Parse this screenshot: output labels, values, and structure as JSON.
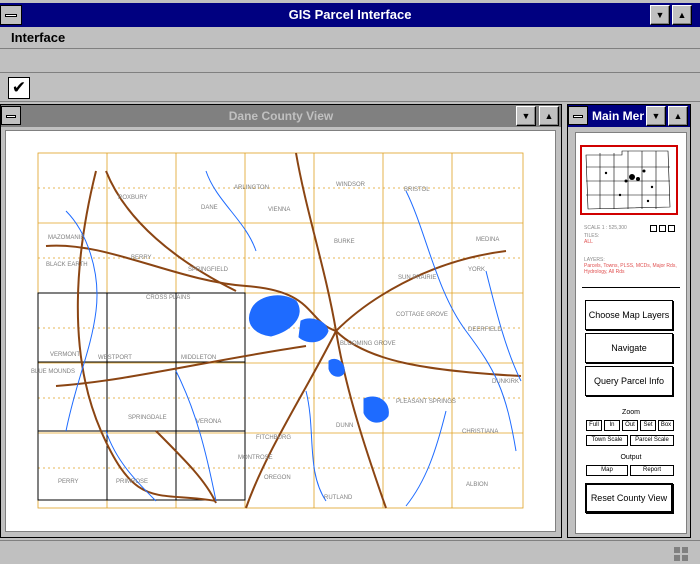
{
  "app": {
    "title": "GIS Parcel Interface",
    "minimize_glyph": "▼",
    "maximize_glyph": "▲"
  },
  "menubar": {
    "items": [
      "Interface"
    ]
  },
  "toolbar": {
    "check_glyph": "✔"
  },
  "map_window": {
    "title": "Dane County View"
  },
  "menu_window": {
    "title": "Main Menu",
    "scale_label": "SCALE 1 : 525,300",
    "tiles_label": "TILES:",
    "tiles_value": "ALL",
    "layers_label": "LAYERS:",
    "layers_value": "Parcels, Towns, PLSS, MCDs, Major Rds, Hydrology, All Rds",
    "buttons": {
      "choose_layers": "Choose Map Layers",
      "navigate": "Navigate",
      "query": "Query Parcel Info",
      "reset": "Reset County View"
    },
    "zoom": {
      "label": "Zoom",
      "full": "Full",
      "in": "In",
      "out": "Out",
      "set": "Set",
      "box": "Box",
      "town_scale": "Town Scale",
      "parcel_scale": "Parcel Scale"
    },
    "output": {
      "label": "Output",
      "map": "Map",
      "report": "Report"
    }
  },
  "map_labels": [
    "WESTPORT",
    "VIENNA",
    "WINDSOR",
    "BRISTOL",
    "DANE",
    "BERRY",
    "BLACK EARTH",
    "SPRINGFIELD",
    "CROSS PLAINS",
    "MIDDLETON",
    "VERMONT",
    "BLUE MOUNDS",
    "FITCHBURG",
    "VERONA",
    "PERRY",
    "PRIMROSE",
    "OREGON",
    "RUTLAND",
    "DUNN",
    "PLEASANT SPRINGS",
    "CHRISTIANA",
    "ALBION",
    "DEERFIELD",
    "COTTAGE GROVE",
    "SUN PRAIRIE",
    "BURKE",
    "MEDINA",
    "YORK",
    "BLOOMING GROVE",
    "DUNKIRK",
    "ROXBURY",
    "MAZOMANIE",
    "MONTROSE",
    "SPRINGDALE",
    "ARLINGTON"
  ],
  "colors": {
    "title_active": "#000080",
    "title_inactive": "#808080",
    "water": "#1e6bff",
    "roads": "#8b4513",
    "boundaries": "#e0a020",
    "inset_border": "#d00000"
  }
}
